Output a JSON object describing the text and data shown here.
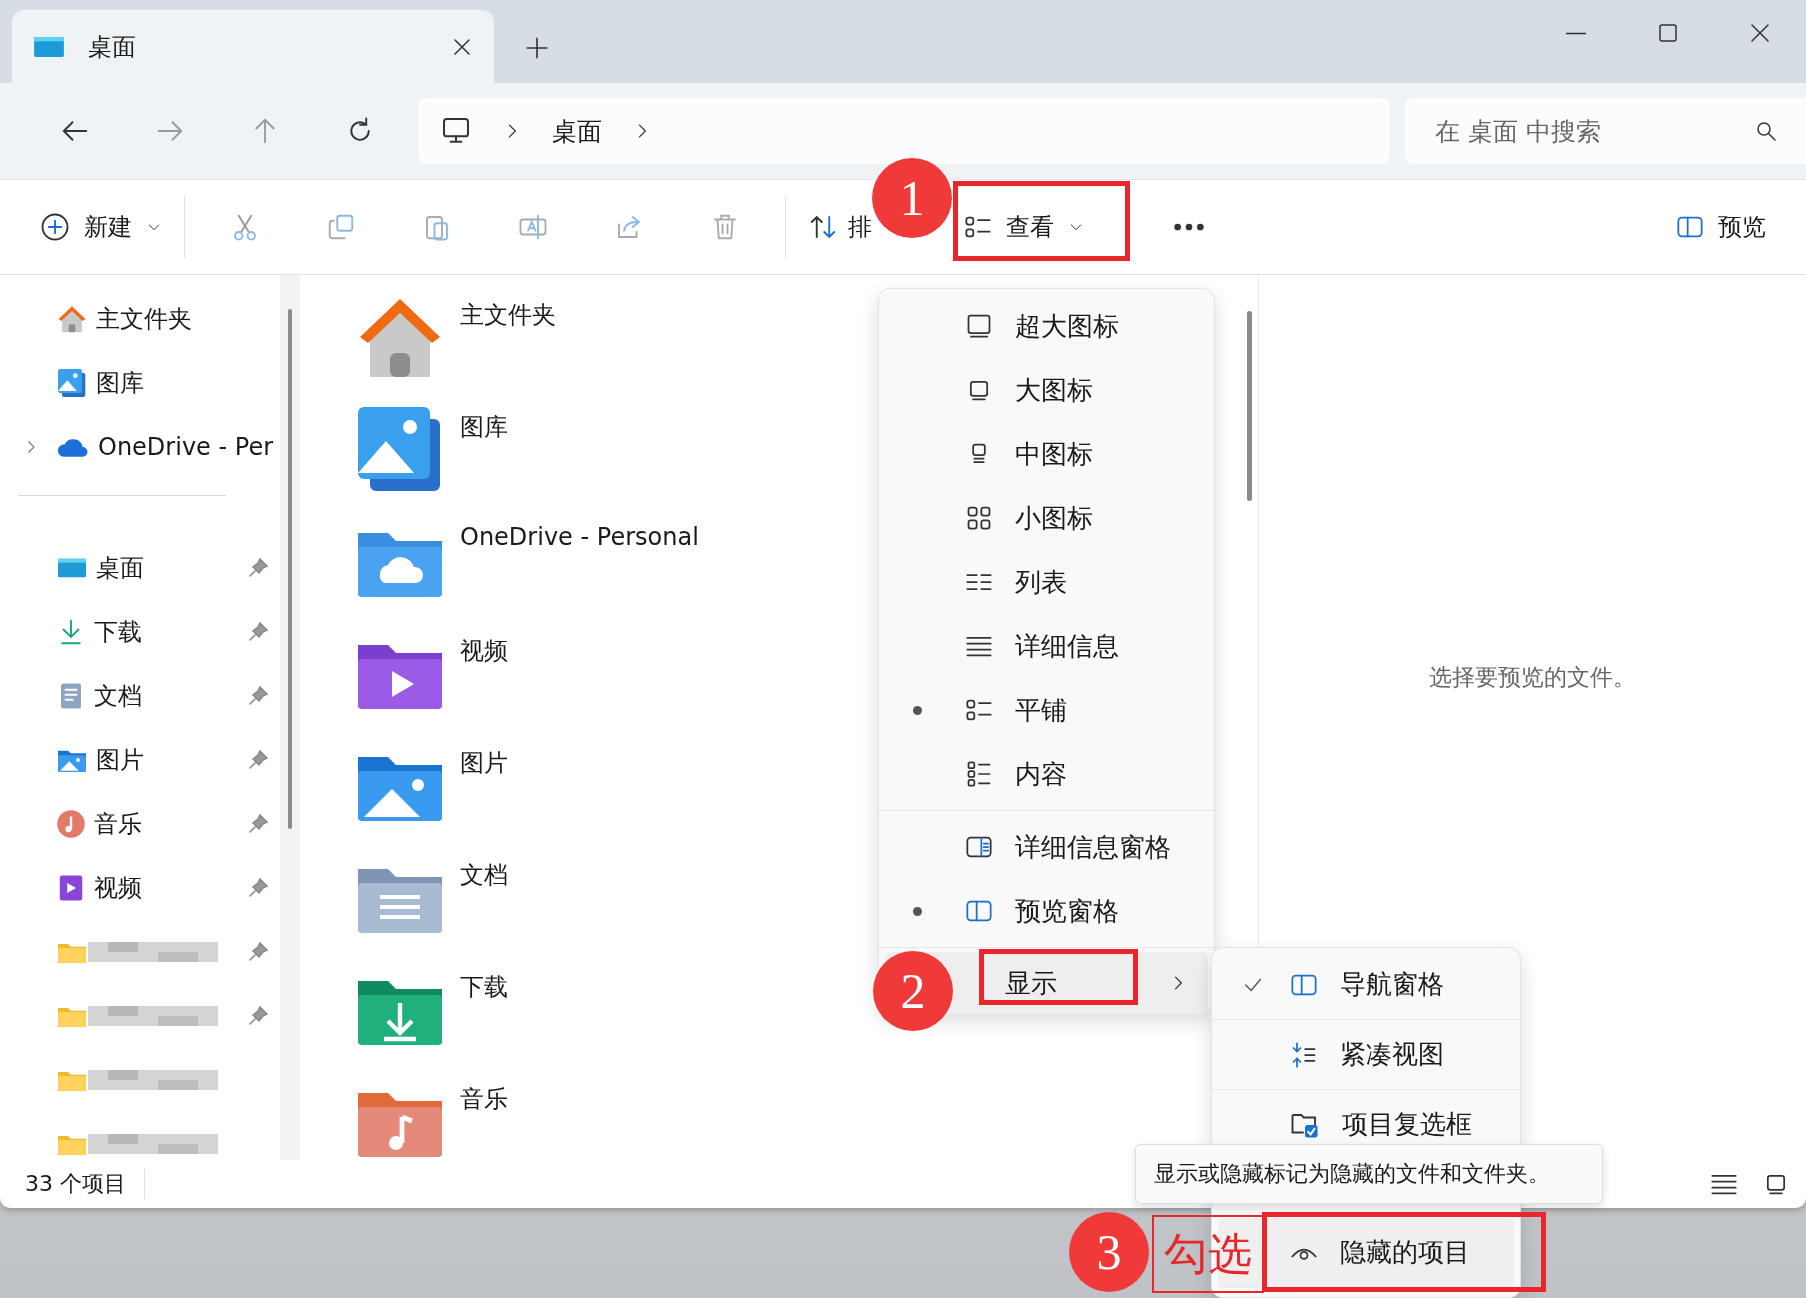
{
  "tab": {
    "title": "桌面",
    "selected": true
  },
  "address": {
    "crumbs": [
      "桌面"
    ],
    "search_placeholder": "在 桌面 中搜索"
  },
  "toolbar": {
    "new": "新建",
    "sort": "排",
    "view": "查看",
    "preview": "预览"
  },
  "sidebar": {
    "top": [
      {
        "kind": "home",
        "label": "主文件夹",
        "expandable": false
      },
      {
        "kind": "gallery",
        "label": "图库",
        "expandable": false
      },
      {
        "kind": "onedrive",
        "label": "OneDrive - Per",
        "expandable": true
      }
    ],
    "pinned": [
      {
        "kind": "desktop",
        "label": "桌面",
        "pinned": true,
        "redacted": false
      },
      {
        "kind": "download",
        "label": "下载",
        "pinned": true,
        "redacted": false
      },
      {
        "kind": "docs",
        "label": "文档",
        "pinned": true,
        "redacted": false
      },
      {
        "kind": "pictures",
        "label": "图片",
        "pinned": true,
        "redacted": false
      },
      {
        "kind": "music",
        "label": "音乐",
        "pinned": true,
        "redacted": false
      },
      {
        "kind": "video",
        "label": "视频",
        "pinned": true,
        "redacted": false
      },
      {
        "kind": "folder",
        "pinned": true,
        "redacted": true
      },
      {
        "kind": "folder",
        "pinned": true,
        "redacted": true
      },
      {
        "kind": "folder",
        "pinned": false,
        "redacted": true
      },
      {
        "kind": "folder",
        "pinned": false,
        "redacted": true
      }
    ]
  },
  "files": [
    {
      "kind": "home",
      "name": "主文件夹"
    },
    {
      "kind": "gallery",
      "name": "图库"
    },
    {
      "kind": "onedrive",
      "name": "OneDrive - Personal"
    },
    {
      "kind": "video",
      "name": "视频"
    },
    {
      "kind": "pictures",
      "name": "图片"
    },
    {
      "kind": "docs",
      "name": "文档"
    },
    {
      "kind": "download",
      "name": "下载"
    },
    {
      "kind": "music",
      "name": "音乐"
    }
  ],
  "preview_message": "选择要预览的文件。",
  "status_bar": {
    "count": "33 个项目"
  },
  "view_menu": {
    "layouts": [
      {
        "label": "超大图标",
        "selected": false
      },
      {
        "label": "大图标",
        "selected": false
      },
      {
        "label": "中图标",
        "selected": false
      },
      {
        "label": "小图标",
        "selected": false
      },
      {
        "label": "列表",
        "selected": false
      },
      {
        "label": "详细信息",
        "selected": false
      },
      {
        "label": "平铺",
        "selected": true
      },
      {
        "label": "内容",
        "selected": false
      }
    ],
    "panes": [
      {
        "label": "详细信息窗格",
        "selected": false
      },
      {
        "label": "预览窗格",
        "selected": true
      }
    ],
    "show": {
      "label": "显示"
    }
  },
  "show_menu": {
    "items": [
      {
        "label": "导航窗格",
        "checked": true,
        "selected": false
      },
      {
        "label": "紧凑视图",
        "checked": false,
        "selected": false
      },
      {
        "label": "项目复选框",
        "checked": false,
        "selected": false
      }
    ],
    "hidden_items": {
      "label": "隐藏的项目",
      "checked": false,
      "selected": true
    }
  },
  "tooltip": "显示或隐藏标记为隐藏的文件和文件夹。",
  "annotations": {
    "steps": [
      "1",
      "2",
      "3"
    ],
    "note": "勾选"
  }
}
